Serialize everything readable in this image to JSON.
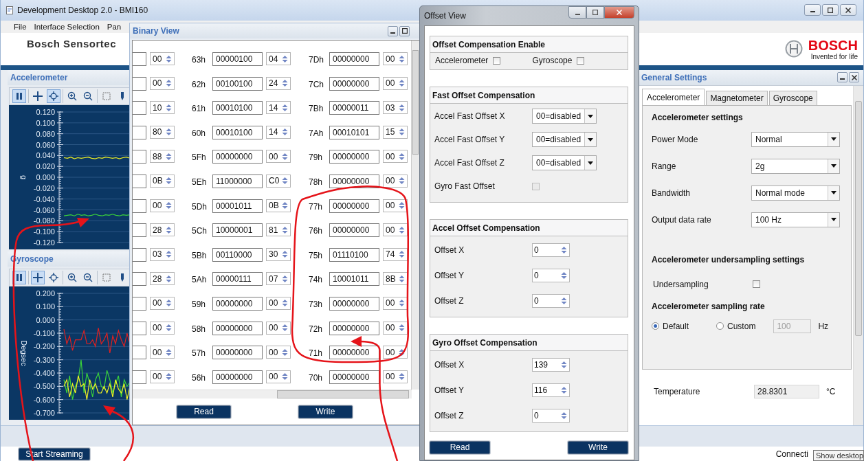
{
  "main_window": {
    "title": "Development Desktop 2.0 - BMI160",
    "menu": [
      "File",
      "Interface Selection",
      "Pan"
    ],
    "header_title": "Bosch Sensortec",
    "brand": {
      "name": "BOSCH",
      "tagline": "Invented for life"
    }
  },
  "plots": [
    {
      "title": "Accelerometer",
      "tools": [
        {
          "kind": "pause",
          "selected": true
        },
        {
          "kind": "pan",
          "selected": false
        },
        {
          "kind": "crosshair",
          "selected": true
        },
        {
          "kind": "zoom-in",
          "selected": false
        },
        {
          "kind": "zoom-out",
          "selected": false
        },
        {
          "kind": "select",
          "selected": false
        },
        {
          "kind": "marker",
          "selected": false
        }
      ],
      "chart_data": {
        "type": "line",
        "ylabel": "g",
        "grid": true,
        "ylim": [
          -0.12,
          0.12
        ],
        "yticks": [
          {
            "value": 0.12,
            "label": "0.120"
          },
          {
            "value": 0.1,
            "label": "0.100"
          },
          {
            "value": 0.08,
            "label": "0.080"
          },
          {
            "value": 0.06,
            "label": "0.060"
          },
          {
            "value": 0.04,
            "label": "0.040"
          },
          {
            "value": 0.02,
            "label": "0.020"
          },
          {
            "value": 0,
            "label": "0.000"
          },
          {
            "value": -0.02,
            "label": "-0.020"
          },
          {
            "value": -0.04,
            "label": "-0.040"
          },
          {
            "value": -0.06,
            "label": "-0.060"
          },
          {
            "value": -0.08,
            "label": "-0.080"
          },
          {
            "value": -0.1,
            "label": "-0.100"
          },
          {
            "value": -0.12,
            "label": "-0.120"
          }
        ],
        "series": [
          {
            "color": "#f2f224",
            "values": [
              0.036,
              0.035,
              0.037,
              0.034,
              0.036,
              0.035,
              0.036,
              0.037,
              0.035,
              0.034,
              0.036,
              0.035,
              0.037,
              0.036,
              0.035,
              0.036,
              0.034,
              0.036,
              0.037,
              0.035
            ]
          },
          {
            "color": "#3ad23a",
            "values": [
              -0.071,
              -0.07,
              -0.069,
              -0.071,
              -0.068,
              -0.07,
              -0.069,
              -0.071,
              -0.07,
              -0.068,
              -0.07,
              -0.071,
              -0.069,
              -0.07,
              -0.068,
              -0.07,
              -0.071,
              -0.069,
              -0.07,
              -0.069
            ]
          }
        ]
      }
    },
    {
      "title": "Gyroscope",
      "tools": [
        {
          "kind": "pause",
          "selected": true
        },
        {
          "kind": "pan",
          "selected": true
        },
        {
          "kind": "crosshair",
          "selected": false
        },
        {
          "kind": "zoom-in",
          "selected": false
        },
        {
          "kind": "zoom-out",
          "selected": false
        },
        {
          "kind": "select",
          "selected": false
        },
        {
          "kind": "marker",
          "selected": false
        }
      ],
      "chart_data": {
        "type": "line",
        "ylabel": "Degsec",
        "grid": true,
        "ylim": [
          -0.7,
          0.2
        ],
        "yticks": [
          {
            "value": 0.2,
            "label": "0.200"
          },
          {
            "value": 0.1,
            "label": "0.100"
          },
          {
            "value": 0,
            "label": "0.000"
          },
          {
            "value": -0.1,
            "label": "-0.100"
          },
          {
            "value": -0.2,
            "label": "-0.200"
          },
          {
            "value": -0.3,
            "label": "-0.300"
          },
          {
            "value": -0.4,
            "label": "-0.400"
          },
          {
            "value": -0.5,
            "label": "-0.500"
          },
          {
            "value": -0.6,
            "label": "-0.600"
          },
          {
            "value": -0.7,
            "label": "-0.700"
          }
        ],
        "series": [
          {
            "color": "#e02020",
            "values": [
              -0.07,
              -0.18,
              -0.12,
              -0.23,
              -0.15,
              -0.15,
              -0.15,
              -0.08,
              -0.18,
              -0.18,
              -0.15,
              -0.2,
              -0.06,
              -0.18,
              -0.15,
              -0.1,
              -0.25,
              -0.12,
              -0.18,
              -0.08,
              -0.15,
              -0.2,
              -0.1,
              -0.18
            ]
          },
          {
            "color": "#3ad23a",
            "values": [
              -0.45,
              -0.55,
              -0.42,
              -0.6,
              -0.5,
              -0.45,
              -0.3,
              -0.55,
              -0.4,
              -0.48,
              -0.58,
              -0.45,
              -0.4,
              -0.5,
              -0.52,
              -0.38,
              -0.45,
              -0.55,
              -0.48,
              -0.42,
              -0.58,
              -0.45,
              -0.5,
              -0.47
            ]
          },
          {
            "color": "#f2f224",
            "values": [
              -0.5,
              -0.45,
              -0.58,
              -0.48,
              -0.55,
              -0.42,
              -0.5,
              -0.48,
              -0.6,
              -0.45,
              -0.52,
              -0.48,
              -0.55,
              -0.55,
              -0.5,
              -0.55,
              -0.48,
              -0.58,
              -0.45,
              -0.52,
              -0.55,
              -0.48,
              -0.6,
              -0.5
            ]
          }
        ]
      }
    }
  ],
  "binary_view": {
    "title": "Binary View",
    "rows": [
      {
        "col_1_hex": "00",
        "registers": [
          {
            "address": "63h",
            "binary": "00000100",
            "hex": "04"
          },
          {
            "address": "7Dh",
            "binary": "00000000",
            "hex": "00"
          }
        ]
      },
      {
        "col_1_hex": "00",
        "registers": [
          {
            "address": "62h",
            "binary": "00100100",
            "hex": "24"
          },
          {
            "address": "7Ch",
            "binary": "00000000",
            "hex": "00"
          }
        ]
      },
      {
        "col_1_hex": "10",
        "registers": [
          {
            "address": "61h",
            "binary": "00010100",
            "hex": "14"
          },
          {
            "address": "7Bh",
            "binary": "00000011",
            "hex": "03"
          }
        ]
      },
      {
        "col_1_hex": "80",
        "registers": [
          {
            "address": "60h",
            "binary": "00010100",
            "hex": "14"
          },
          {
            "address": "7Ah",
            "binary": "00010101",
            "hex": "15"
          }
        ]
      },
      {
        "col_1_hex": "88",
        "registers": [
          {
            "address": "5Fh",
            "binary": "00000000",
            "hex": "00"
          },
          {
            "address": "79h",
            "binary": "00000000",
            "hex": "00"
          }
        ]
      },
      {
        "col_1_hex": "0B",
        "registers": [
          {
            "address": "5Eh",
            "binary": "11000000",
            "hex": "C0"
          },
          {
            "address": "78h",
            "binary": "00000000",
            "hex": "00"
          }
        ]
      },
      {
        "col_1_hex": "00",
        "registers": [
          {
            "address": "5Dh",
            "binary": "00001011",
            "hex": "0B"
          },
          {
            "address": "77h",
            "binary": "00000000",
            "hex": "00"
          }
        ]
      },
      {
        "col_1_hex": "28",
        "registers": [
          {
            "address": "5Ch",
            "binary": "10000001",
            "hex": "81"
          },
          {
            "address": "76h",
            "binary": "00000000",
            "hex": "00"
          }
        ]
      },
      {
        "col_1_hex": "03",
        "registers": [
          {
            "address": "5Bh",
            "binary": "00110000",
            "hex": "30"
          },
          {
            "address": "75h",
            "binary": "01110100",
            "hex": "74"
          }
        ]
      },
      {
        "col_1_hex": "28",
        "registers": [
          {
            "address": "5Ah",
            "binary": "00000111",
            "hex": "07"
          },
          {
            "address": "74h",
            "binary": "10001011",
            "hex": "8B"
          }
        ]
      },
      {
        "col_1_hex": "00",
        "registers": [
          {
            "address": "59h",
            "binary": "00000000",
            "hex": "00"
          },
          {
            "address": "73h",
            "binary": "00000000",
            "hex": "00"
          }
        ]
      },
      {
        "col_1_hex": "00",
        "registers": [
          {
            "address": "58h",
            "binary": "00000000",
            "hex": "00"
          },
          {
            "address": "72h",
            "binary": "00000000",
            "hex": "00"
          }
        ]
      },
      {
        "col_1_hex": "00",
        "registers": [
          {
            "address": "57h",
            "binary": "00000000",
            "hex": "00"
          },
          {
            "address": "71h",
            "binary": "00000000",
            "hex": "00"
          }
        ]
      },
      {
        "col_1_hex": "00",
        "registers": [
          {
            "address": "56h",
            "binary": "00000000",
            "hex": "00"
          },
          {
            "address": "70h",
            "binary": "00000000",
            "hex": "00"
          }
        ]
      }
    ],
    "buttons": [
      "Read",
      "Write"
    ]
  },
  "offset_view": {
    "title": "Offset View",
    "sections": [
      {
        "title": "Offset Compensation Enable",
        "kind": "inline",
        "rows": [
          {
            "kind": "checkbox",
            "label": "Accelerometer",
            "checked": false,
            "disabled": false
          },
          {
            "kind": "checkbox",
            "label": "Gyroscope",
            "checked": false,
            "disabled": false
          }
        ]
      },
      {
        "title": "Fast Offset Compensation",
        "kind": "form",
        "rows": [
          {
            "kind": "select",
            "label": "Accel Fast Offset X",
            "value": "00=disabled"
          },
          {
            "kind": "select",
            "label": "Accel Fast Offset Y",
            "value": "00=disabled"
          },
          {
            "kind": "select",
            "label": "Accel Fast Offset Z",
            "value": "00=disabled"
          },
          {
            "kind": "checkbox",
            "label": "Gyro Fast Offset",
            "checked": false,
            "disabled": true
          }
        ]
      },
      {
        "title": "Accel Offset Compensation",
        "kind": "form",
        "rows": [
          {
            "kind": "spinner",
            "label": "Offset X",
            "value": "0"
          },
          {
            "kind": "spinner",
            "label": "Offset Y",
            "value": "0"
          },
          {
            "kind": "spinner",
            "label": "Offset Z",
            "value": "0"
          }
        ]
      },
      {
        "title": "Gyro Offset Compensation",
        "kind": "form",
        "rows": [
          {
            "kind": "spinner",
            "label": "Offset X",
            "value": "139"
          },
          {
            "kind": "spinner",
            "label": "Offset Y",
            "value": "116"
          },
          {
            "kind": "spinner",
            "label": "Offset Z",
            "value": "0"
          }
        ]
      }
    ],
    "buttons": [
      "Read",
      "Write"
    ]
  },
  "general_settings": {
    "title": "General Settings",
    "tabs": [
      {
        "label": "Accelerometer",
        "selected": true
      },
      {
        "label": "Magnetometer",
        "selected": false
      },
      {
        "label": "Gyroscope",
        "selected": false
      }
    ],
    "section_title": "Accelerometer settings",
    "fields": [
      {
        "label": "Power Mode",
        "value": "Normal"
      },
      {
        "label": "Range",
        "value": "2g"
      },
      {
        "label": "Bandwidth",
        "value": "Normal mode"
      },
      {
        "label": "Output data rate",
        "value": "100 Hz"
      }
    ],
    "undersampling_title": "Accelerometer undersampling settings",
    "undersampling": {
      "label": "Undersampling",
      "checked": false
    },
    "sampling_title": "Accelerometer sampling rate",
    "sampling_options": [
      {
        "label": "Default",
        "selected": true
      },
      {
        "label": "Custom",
        "selected": false
      }
    ],
    "custom_rate": {
      "value": "100",
      "disabled": true,
      "unit": "Hz"
    },
    "temperature": {
      "label": "Temperature",
      "value": "28.8301",
      "unit": "°C"
    }
  },
  "status": {
    "start_button": "Start Streaming",
    "connection": "Connecti",
    "tooltip": "Show desktop"
  }
}
